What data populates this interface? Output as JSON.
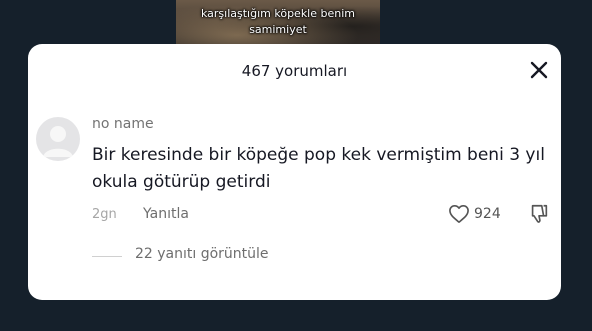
{
  "video": {
    "caption_lines": [
      "karşılaştığım köpekle benim",
      "samimiyet"
    ]
  },
  "comments_sheet": {
    "title": "467 yorumları",
    "close_icon": "close-icon"
  },
  "comment": {
    "avatar_icon": "default-avatar-icon",
    "username": "no name",
    "text": "Bir keresinde bir köpeğe pop kek vermiştim beni 3 yıl okula götürüp getirdi",
    "time": "2gn",
    "reply_label": "Yanıtla",
    "like_count": "924",
    "like_icon": "heart-icon",
    "dislike_icon": "thumbs-down-icon",
    "view_replies": "22 yanıtı görüntüle"
  },
  "colors": {
    "page_background": "#15202b",
    "sheet_background": "#ffffff",
    "primary_text": "#161823",
    "secondary_text": "#737373"
  }
}
